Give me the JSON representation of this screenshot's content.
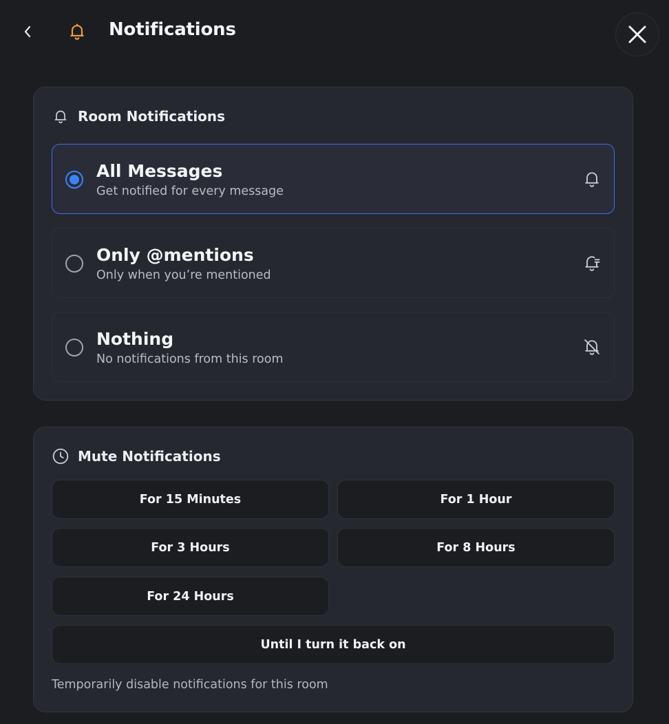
{
  "header": {
    "title": "Notifications",
    "accent_color": "#f59e42",
    "icons": {
      "back": "chevron-left-icon",
      "bell": "bell-icon",
      "close": "close-icon"
    }
  },
  "room": {
    "title": "Room Notifications",
    "icon": "bell-icon",
    "selected": "all",
    "options": [
      {
        "id": "all",
        "title": "All Messages",
        "description": "Get notified for every message",
        "icon": "bell-icon"
      },
      {
        "id": "mentions",
        "title": "Only @mentions",
        "description": "Only when you’re mentioned",
        "icon": "bell-mention-icon"
      },
      {
        "id": "nothing",
        "title": "Nothing",
        "description": "No notifications from this room",
        "icon": "bell-off-icon"
      }
    ]
  },
  "mute": {
    "title": "Mute Notifications",
    "icon": "clock-icon",
    "buttons": [
      "For 15 Minutes",
      "For 1 Hour",
      "For 3 Hours",
      "For 8 Hours",
      "For 24 Hours",
      "Until I turn it back on"
    ],
    "helper": "Temporarily disable notifications for this room"
  },
  "colors": {
    "accent_blue": "#3b82f6",
    "background": "#1c1d21",
    "card": "#262830"
  }
}
